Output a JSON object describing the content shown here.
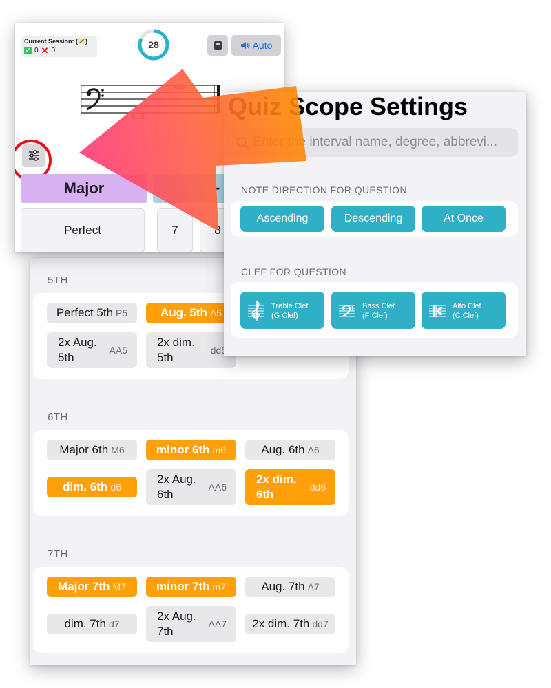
{
  "quiz": {
    "session_label": "Current Session: (",
    "session_icon": "pencil-icon",
    "correct_count": "0",
    "wrong_count": "0",
    "timer": "28",
    "timer_progress": 0.82,
    "auto_label": "Auto",
    "quality_label": "Major",
    "dash_label": "-",
    "perfect_label": "Perfect",
    "num_7": "7",
    "num_8": "8",
    "clef": "bass",
    "colors": {
      "major": "#d7b2f2",
      "dash": "#a8d4e6",
      "timer_ring": "#2ab0c8"
    }
  },
  "settings": {
    "title": "Quiz Scope Settings",
    "search_placeholder": "Enter the interval name, degree, abbrevi...",
    "direction_header": "NOTE DIRECTION FOR QUESTION",
    "direction_options": [
      "Ascending",
      "Descending",
      "At Once"
    ],
    "clef_header": "CLEF FOR QUESTION",
    "clef_options": [
      {
        "name": "Treble Clef",
        "sub": "(G Clef)",
        "icon": "treble-clef-icon"
      },
      {
        "name": "Bass Clef",
        "sub": "(F Clef)",
        "icon": "bass-clef-icon"
      },
      {
        "name": "Alto Clef",
        "sub": "(C Clef)",
        "icon": "alto-clef-icon"
      }
    ],
    "accent_color": "#30b0c7"
  },
  "intervals": {
    "selected_color": "#ff9f0a",
    "sections": [
      {
        "header": "5TH",
        "items": [
          {
            "name": "Perfect 5th",
            "abbr": "P5",
            "selected": false
          },
          {
            "name": "Aug. 5th",
            "abbr": "A5",
            "selected": true
          },
          {
            "name": "2x Aug. 5th",
            "abbr": "AA5",
            "selected": false
          },
          {
            "name": "2x dim. 5th",
            "abbr": "dd5",
            "selected": false
          }
        ]
      },
      {
        "header": "6TH",
        "items": [
          {
            "name": "Major 6th",
            "abbr": "M6",
            "selected": false
          },
          {
            "name": "minor 6th",
            "abbr": "m6",
            "selected": true
          },
          {
            "name": "Aug. 6th",
            "abbr": "A6",
            "selected": false
          },
          {
            "name": "dim. 6th",
            "abbr": "d6",
            "selected": true
          },
          {
            "name": "2x Aug. 6th",
            "abbr": "AA6",
            "selected": false
          },
          {
            "name": "2x dim. 6th",
            "abbr": "dd6",
            "selected": true
          }
        ]
      },
      {
        "header": "7TH",
        "items": [
          {
            "name": "Major 7th",
            "abbr": "M7",
            "selected": true
          },
          {
            "name": "minor 7th",
            "abbr": "m7",
            "selected": true
          },
          {
            "name": "Aug. 7th",
            "abbr": "A7",
            "selected": false
          },
          {
            "name": "dim. 7th",
            "abbr": "d7",
            "selected": false
          },
          {
            "name": "2x Aug. 7th",
            "abbr": "AA7",
            "selected": false
          },
          {
            "name": "2x dim. 7th",
            "abbr": "dd7",
            "selected": false
          }
        ]
      }
    ]
  },
  "annotation": {
    "arrow_icon": "pointer-arrow-icon",
    "highlight": "red-circle-highlight"
  }
}
